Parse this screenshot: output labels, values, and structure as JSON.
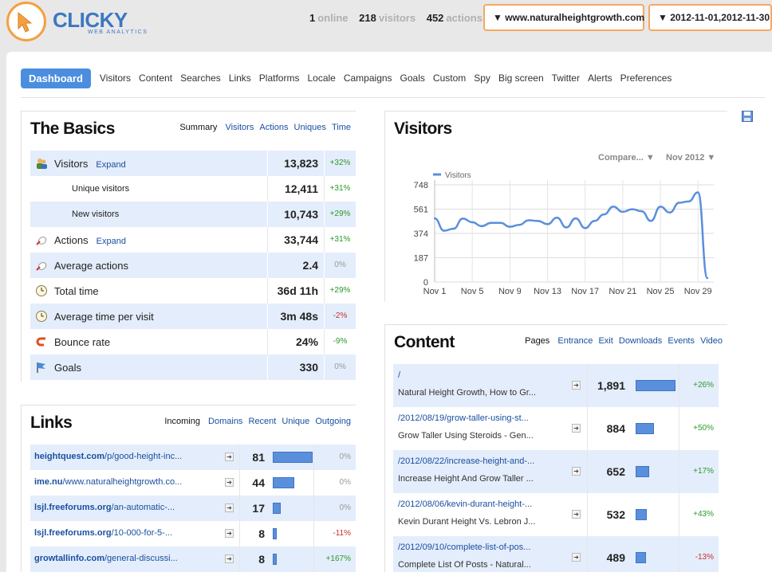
{
  "header": {
    "logo_text": "CLICKY",
    "logo_sub": "WEB ANALYTICS",
    "online_count": "1",
    "online_label": "online",
    "visitors_count": "218",
    "visitors_label": "visitors",
    "actions_count": "452",
    "actions_label": "actions",
    "site_selector": "▼ www.naturalheightgrowth.com",
    "date_selector": "▼ 2012-11-01,2012-11-30"
  },
  "nav": {
    "active": "Dashboard",
    "items": [
      "Visitors",
      "Content",
      "Searches",
      "Links",
      "Platforms",
      "Locale",
      "Campaigns",
      "Goals",
      "Custom",
      "Spy",
      "Big screen",
      "Twitter",
      "Alerts",
      "Preferences"
    ]
  },
  "basics": {
    "title": "The Basics",
    "tab_current": "Summary",
    "tabs": [
      "Visitors",
      "Actions",
      "Uniques",
      "Time"
    ],
    "rows": [
      {
        "name": "Visitors",
        "expand": "Expand",
        "value": "13,823",
        "change": "+32%",
        "trend": "pos",
        "icon": "visitors-icon",
        "sub": false
      },
      {
        "name": "Unique visitors",
        "expand": "",
        "value": "12,411",
        "change": "+31%",
        "trend": "pos",
        "icon": "",
        "sub": true
      },
      {
        "name": "New visitors",
        "expand": "",
        "value": "10,743",
        "change": "+29%",
        "trend": "pos",
        "icon": "",
        "sub": true
      },
      {
        "name": "Actions",
        "expand": "Expand",
        "value": "33,744",
        "change": "+31%",
        "trend": "pos",
        "icon": "actions-icon",
        "sub": false
      },
      {
        "name": "Average actions",
        "expand": "",
        "value": "2.4",
        "change": "0%",
        "trend": "neu",
        "icon": "actions-icon",
        "sub": false
      },
      {
        "name": "Total time",
        "expand": "",
        "value": "36d 11h",
        "change": "+29%",
        "trend": "pos",
        "icon": "clock-icon",
        "sub": false
      },
      {
        "name": "Average time per visit",
        "expand": "",
        "value": "3m 48s",
        "change": "-2%",
        "trend": "neg",
        "icon": "clock-icon",
        "sub": false
      },
      {
        "name": "Bounce rate",
        "expand": "",
        "value": "24%",
        "change": "-9%",
        "trend": "pos",
        "icon": "bounce-icon",
        "sub": false
      },
      {
        "name": "Goals",
        "expand": "",
        "value": "330",
        "change": "0%",
        "trend": "neu",
        "icon": "flag-icon",
        "sub": false
      }
    ]
  },
  "visitors_panel": {
    "title": "Visitors",
    "compare_label": "Compare... ▼",
    "month_label": "Nov 2012 ▼"
  },
  "chart_data": {
    "type": "line",
    "title": "",
    "xlabel": "",
    "ylabel": "",
    "legend": "top-left",
    "grid": true,
    "ylim": [
      0,
      748
    ],
    "yticks": [
      0,
      187,
      374,
      561,
      748
    ],
    "xticks": [
      "Nov 1",
      "Nov 5",
      "Nov 9",
      "Nov 13",
      "Nov 17",
      "Nov 21",
      "Nov 25",
      "Nov 29"
    ],
    "x": [
      "Nov 1",
      "Nov 2",
      "Nov 3",
      "Nov 4",
      "Nov 5",
      "Nov 6",
      "Nov 7",
      "Nov 8",
      "Nov 9",
      "Nov 10",
      "Nov 11",
      "Nov 12",
      "Nov 13",
      "Nov 14",
      "Nov 15",
      "Nov 16",
      "Nov 17",
      "Nov 18",
      "Nov 19",
      "Nov 20",
      "Nov 21",
      "Nov 22",
      "Nov 23",
      "Nov 24",
      "Nov 25",
      "Nov 26",
      "Nov 27",
      "Nov 28",
      "Nov 29",
      "Nov 30"
    ],
    "series": [
      {
        "name": "Visitors",
        "color": "#5a8fdc",
        "values": [
          490,
          395,
          410,
          488,
          460,
          430,
          455,
          455,
          425,
          440,
          475,
          470,
          445,
          495,
          420,
          490,
          415,
          470,
          520,
          580,
          540,
          560,
          545,
          470,
          580,
          535,
          610,
          620,
          690,
          30
        ]
      }
    ]
  },
  "links_panel": {
    "title": "Links",
    "tab_current": "Incoming",
    "tabs": [
      "Domains",
      "Recent",
      "Unique",
      "Outgoing"
    ],
    "max": 81,
    "rows": [
      {
        "domain": "heightquest.com",
        "path": "/p/good-height-inc...",
        "count": 81,
        "change": "0%",
        "trend": "neu"
      },
      {
        "domain": "ime.nu",
        "path": "/www.naturalheightgrowth.co...",
        "count": 44,
        "change": "0%",
        "trend": "neu"
      },
      {
        "domain": "lsjl.freeforums.org",
        "path": "/an-automatic-...",
        "count": 17,
        "change": "0%",
        "trend": "neu"
      },
      {
        "domain": "lsjl.freeforums.org",
        "path": "/10-000-for-5-...",
        "count": 8,
        "change": "-11%",
        "trend": "neg"
      },
      {
        "domain": "growtallinfo.com",
        "path": "/general-discussi...",
        "count": 8,
        "change": "+167%",
        "trend": "pos"
      }
    ]
  },
  "content_panel": {
    "title": "Content",
    "tab_current": "Pages",
    "tabs": [
      "Entrance",
      "Exit",
      "Downloads",
      "Events",
      "Video"
    ],
    "max": 1891,
    "rows": [
      {
        "url": "/",
        "title": "Natural Height Growth, How to Gr...",
        "count": "1,891",
        "count_num": 1891,
        "change": "+26%",
        "trend": "pos"
      },
      {
        "url": "/2012/08/19/grow-taller-using-st...",
        "title": "Grow Taller Using Steroids - Gen...",
        "count": "884",
        "count_num": 884,
        "change": "+50%",
        "trend": "pos"
      },
      {
        "url": "/2012/08/22/increase-height-and-...",
        "title": "Increase Height And Grow Taller ...",
        "count": "652",
        "count_num": 652,
        "change": "+17%",
        "trend": "pos"
      },
      {
        "url": "/2012/08/06/kevin-durant-height-...",
        "title": "Kevin Durant Height Vs. Lebron J...",
        "count": "532",
        "count_num": 532,
        "change": "+43%",
        "trend": "pos"
      },
      {
        "url": "/2012/09/10/complete-list-of-pos...",
        "title": "Complete List Of Posts - Natural...",
        "count": "489",
        "count_num": 489,
        "change": "-13%",
        "trend": "neg"
      }
    ]
  }
}
